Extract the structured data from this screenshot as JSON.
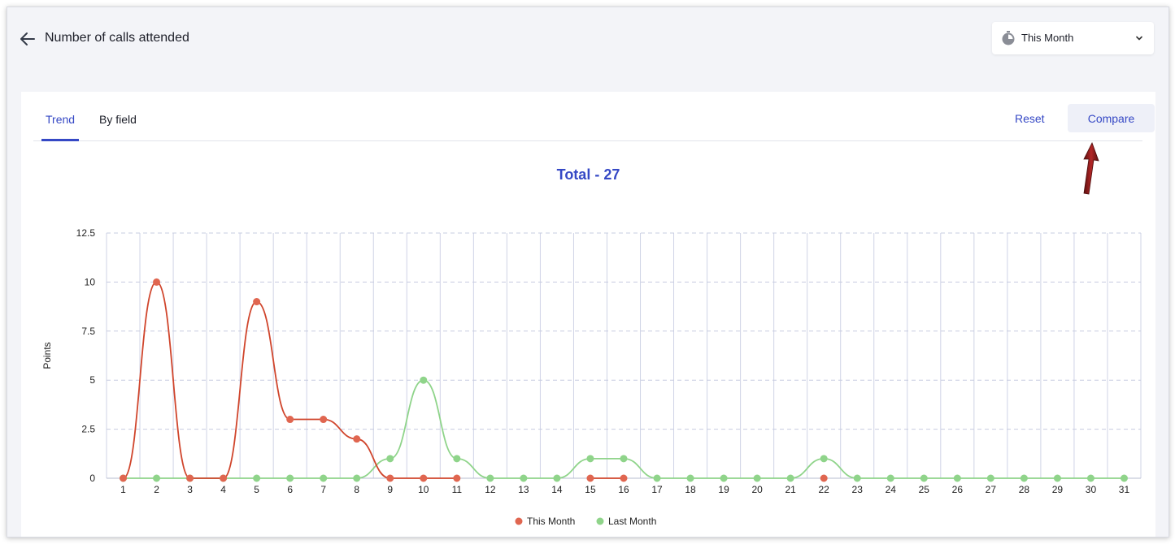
{
  "header": {
    "title": "Number of calls attended",
    "period_label": "This Month"
  },
  "tabs": [
    {
      "label": "Trend",
      "active": true
    },
    {
      "label": "By field",
      "active": false
    }
  ],
  "actions": {
    "reset_label": "Reset",
    "compare_label": "Compare"
  },
  "summary": {
    "total_label": "Total - 27"
  },
  "colors": {
    "accent": "#3548c5",
    "this_month": "#d0452c",
    "this_month_point": "#e06650",
    "last_month": "#8fd48a",
    "annotation_arrow": "#8b1a1a"
  },
  "chart_data": {
    "type": "line",
    "title": "Total - 27",
    "xlabel": "",
    "ylabel": "Points",
    "x": [
      1,
      2,
      3,
      4,
      5,
      6,
      7,
      8,
      9,
      10,
      11,
      12,
      13,
      14,
      15,
      16,
      17,
      18,
      19,
      20,
      21,
      22,
      23,
      24,
      25,
      26,
      27,
      28,
      29,
      30,
      31
    ],
    "x_tick_labels": [
      "1",
      "2",
      "3",
      "4",
      "5",
      "6",
      "7",
      "8",
      "9",
      "10",
      "11",
      "12",
      "13",
      "14",
      "15",
      "16",
      "17",
      "18",
      "19",
      "20",
      "21",
      "22",
      "23",
      "24",
      "25",
      "26",
      "27",
      "28",
      "29",
      "30",
      "31"
    ],
    "y_tick_labels": [
      "0",
      "2.5",
      "5",
      "7.5",
      "10",
      "12.5"
    ],
    "ylim": [
      0,
      12.5
    ],
    "grid": true,
    "legend_position": "bottom",
    "series": [
      {
        "name": "This Month",
        "values": [
          0,
          10,
          0,
          0,
          9,
          3,
          3,
          2,
          0,
          0,
          0,
          null,
          null,
          null,
          0,
          0,
          null,
          null,
          null,
          null,
          null,
          0,
          null,
          null,
          null,
          null,
          null,
          null,
          null,
          null,
          null
        ]
      },
      {
        "name": "Last Month",
        "values": [
          0,
          0,
          0,
          0,
          0,
          0,
          0,
          0,
          1,
          5,
          1,
          0,
          0,
          0,
          1,
          1,
          0,
          0,
          0,
          0,
          0,
          1,
          0,
          0,
          0,
          0,
          0,
          0,
          0,
          0,
          0
        ]
      }
    ]
  }
}
